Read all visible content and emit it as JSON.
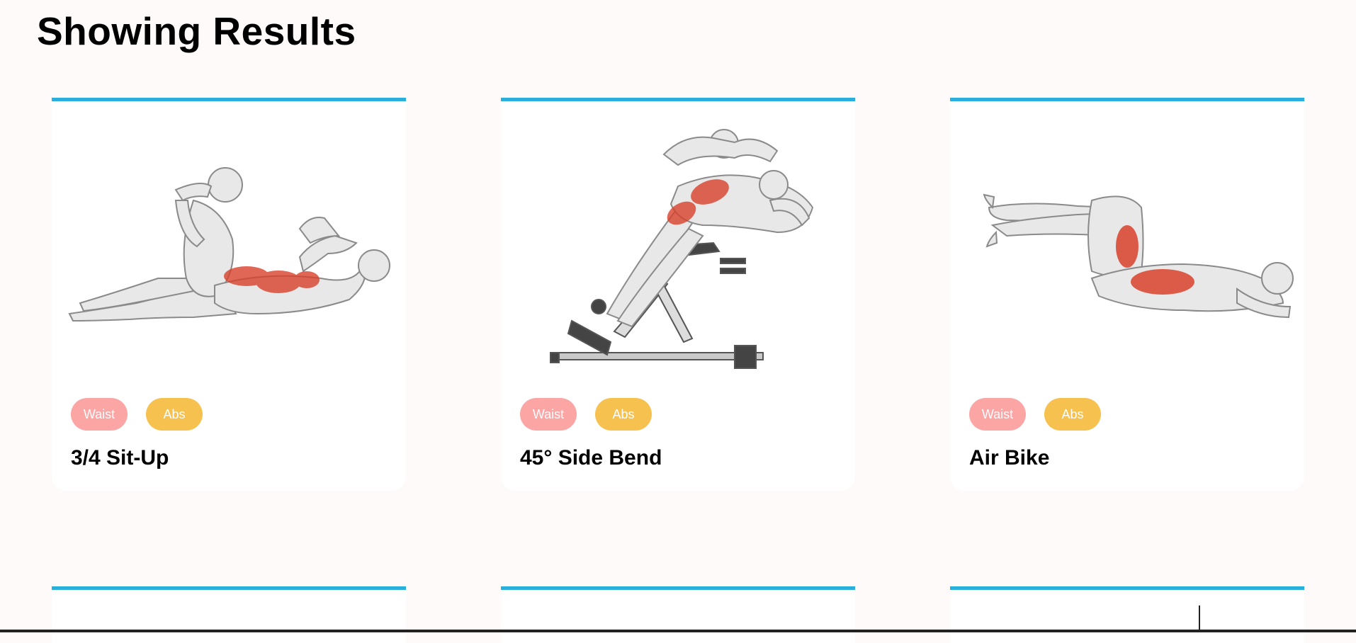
{
  "page": {
    "title": "Showing Results"
  },
  "colors": {
    "accent": "#2aaedb",
    "waist_tag": "#fca5a5",
    "abs_tag": "#f7c150",
    "muscle": "#d9412b"
  },
  "cards": [
    {
      "name": "3/4 Sit-Up",
      "tags": [
        "Waist",
        "Abs"
      ],
      "image": "sit-up-illustration"
    },
    {
      "name": "45° Side Bend",
      "tags": [
        "Waist",
        "Abs"
      ],
      "image": "side-bend-illustration"
    },
    {
      "name": "Air Bike",
      "tags": [
        "Waist",
        "Abs"
      ],
      "image": "air-bike-illustration"
    }
  ]
}
